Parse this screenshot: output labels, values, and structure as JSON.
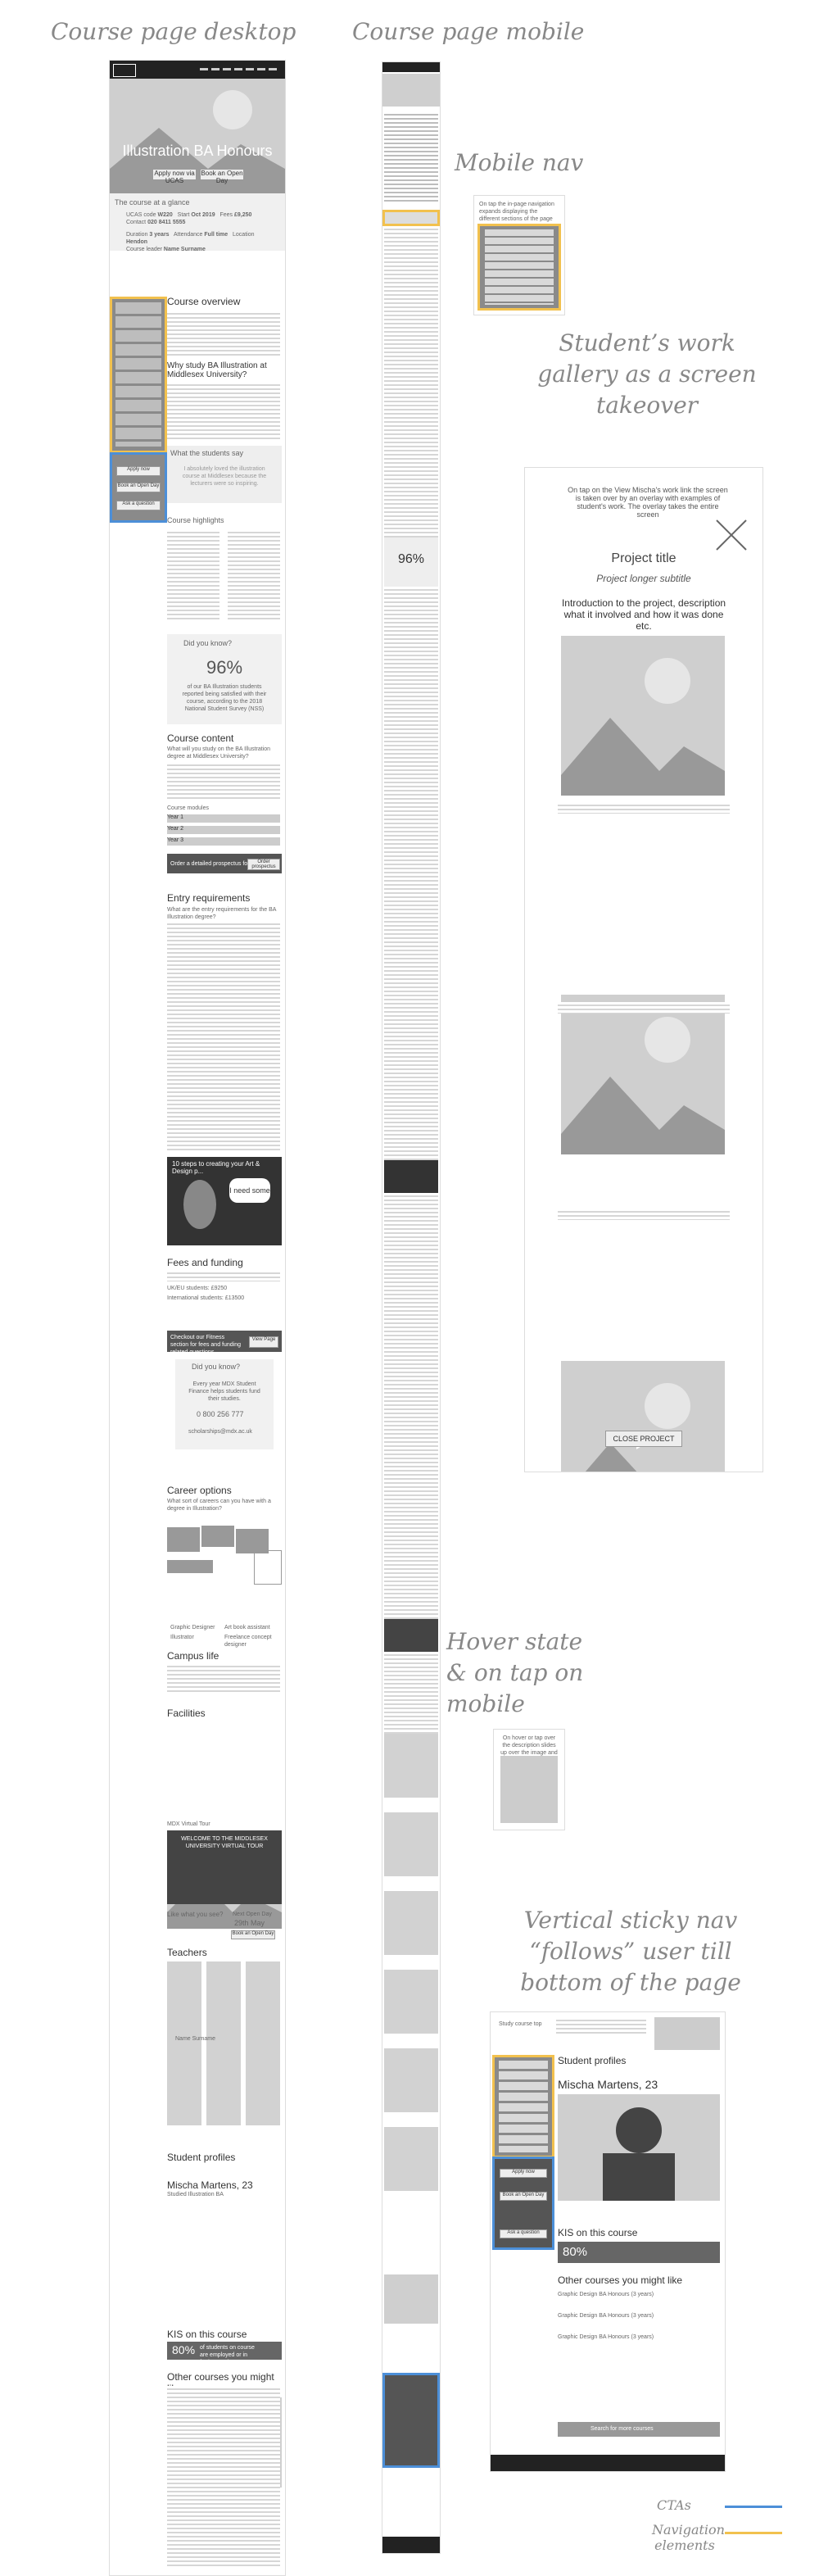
{
  "headings": {
    "desktop": "Course page desktop",
    "mobile": "Course page mobile",
    "mobile_nav": "Mobile nav",
    "gallery": "Student’s work gallery as a screen takeover",
    "hover": "Hover state & on tap on mobile",
    "sticky": "Vertical sticky nav “follows” user till bottom of the page"
  },
  "legend": {
    "ctas": "CTAs",
    "navigation": "Navigation elements",
    "cta_color": "#4c8fd8",
    "nav_color": "#f2c14e"
  },
  "desktop": {
    "hero_title": "Illustration BA Honours",
    "hero_apply": "Apply now via UCAS",
    "hero_open_day": "Book an Open Day",
    "glance_title": "The course at a glance",
    "glance_labels": [
      "UCAS code",
      "Start",
      "Fees",
      "Contact",
      "Duration",
      "Attendance",
      "Location",
      "Course leader"
    ],
    "glance_values": [
      "W220",
      "Oct 2019",
      "£9,250",
      "020 8411 5555",
      "3 years",
      "Full time",
      "Hendon",
      "Name Surname"
    ],
    "nav_items": [
      "Course overview",
      "Course content",
      "Entry requirements",
      "Fees and funding",
      "Career options",
      "Campus life",
      "Facilities",
      "Teachers",
      "Student profiles",
      "Other courses"
    ],
    "cta_items": [
      "Apply now",
      "Book an Open Day",
      "Ask a question"
    ],
    "overview_title": "Course overview",
    "why_title": "Why study BA Illustration at Middlesex University?",
    "what_students_say": "What the students say",
    "quote": "I absolutely loved the illustration course at Middlesex because the lecturers were so inspiring.",
    "highlights_title": "Course highlights",
    "did_you_know": "Did you know?",
    "stat": "96%",
    "stat_text": "of our BA Illustration students reported being satisfied with their course, according to the 2018 National Student Survey (NSS)",
    "content_title": "Course content",
    "content_sub": "What will you study on the BA Illustration degree at Middlesex University?",
    "modules_title": "Course modules",
    "modules": [
      "Year 1",
      "Year 2",
      "Year 3"
    ],
    "prospectus": "Order a detailed prospectus for this course",
    "prospectus_btn": "Order prospectus",
    "entry_title": "Entry requirements",
    "entry_sub": "What are the entry requirements for the BA Illustration degree?",
    "video_title": "10 steps to creating your Art & Design p...",
    "video_bubble": "I need some",
    "fees_title": "Fees and funding",
    "fees_uk": "UK/EU students: £9250",
    "fees_int": "International students: £13500",
    "finance_cta": "Checkout our Fitness section for fees and funding related questions",
    "finance_btn": "View Page",
    "did_you_know2": "Did you know?",
    "finance_text": "Every year MDX Student Finance helps students fund their studies.",
    "phone": "0 800 256 777",
    "email": "scholarships@mdx.ac.uk",
    "careers_title": "Career options",
    "careers_sub": "What sort of careers can you have with a degree in Illustration?",
    "careers_list": [
      "Graphic Designer",
      "Art book assistant",
      "Illustrator",
      "Freelance concept designer"
    ],
    "campus_title": "Campus life",
    "facilities_title": "Facilities",
    "virtual_tour_label": "MDX Virtual Tour",
    "virtual_tour_title": "WELCOME TO THE MIDDLESEX UNIVERSITY VIRTUAL TOUR",
    "like_what": "Like what you see?",
    "next_open_day": "Next Open Day",
    "open_day_date": "29th May",
    "book_btn": "Book an Open Day",
    "teachers_title": "Teachers",
    "teacher_name": "Name Surname",
    "profiles_title": "Student profiles",
    "profile_name": "Mischa Martens, 23",
    "profile_course": "Studied Illustration BA",
    "kis_title": "KIS on this course",
    "kis_stat": "80%",
    "kis_text": "of students on course are employed or in further study",
    "other_title": "Other courses you might like"
  },
  "gallery": {
    "intro": "On tap on the View Mischa's work link the screen is taken over by an overlay with examples of student's work. The overlay takes the entire screen",
    "project_title": "Project title",
    "subtitle": "Project longer subtitle",
    "description": "Introduction to the project, description what it involved and how it was done etc.",
    "close": "CLOSE PROJECT"
  },
  "mobile_nav_note": "On tap the in-page navigation expands displaying the different sections of the page",
  "hover_note": "On hover or tap over the description slides up over the image and some more text is shown",
  "sticky": {
    "course_title": "Study course top",
    "profiles_title": "Student profiles",
    "profile_name": "Mischa Martens, 23",
    "kis_title": "KIS on this course",
    "kis_stat": "80%",
    "other_title": "Other courses you might like",
    "other_items": [
      "Graphic Design BA Honours (3 years)",
      "Graphic Design BA Honours (3 years)",
      "Graphic Design BA Honours (3 years)"
    ],
    "search": "Search for more courses"
  }
}
